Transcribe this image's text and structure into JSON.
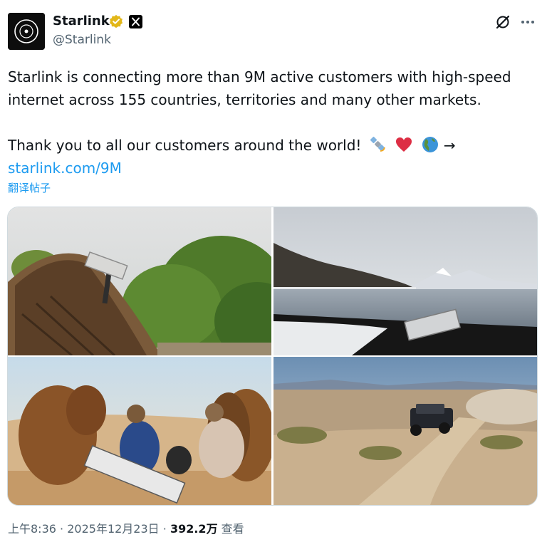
{
  "author": {
    "display_name": "Starlink",
    "handle": "@Starlink",
    "verified_color": "#e2b719",
    "avatar_icon": "starlink-logo",
    "affiliate_badge": "x-logo"
  },
  "header_icons": {
    "grok": "grok-icon",
    "more": "more-icon"
  },
  "tweet": {
    "line1": "Starlink is connecting more than 9M active customers with high-speed",
    "line2": "internet across 155 countries, territories and many other markets.",
    "line3": "Thank you to all our customers around the world!",
    "emojis": [
      "satellite",
      "red-heart",
      "globe-americas"
    ],
    "arrow": "→",
    "link": "starlink.com/9M"
  },
  "translate_label": "翻译帖子",
  "media": [
    {
      "subject": "Starlink dish on thatched roof with trees"
    },
    {
      "subject": "Starlink dish on vehicle hood by lake with snowy mountain"
    },
    {
      "subject": "Starlink dish in desert with camels and people"
    },
    {
      "subject": "Off-road truck driving through desert"
    }
  ],
  "meta": {
    "time": "上午8:36",
    "separator": "·",
    "date": "2025年12月23日",
    "views_count": "392.2万",
    "views_label": "查看"
  },
  "colors": {
    "text": "#0f1419",
    "secondary": "#536471",
    "link": "#1d9bf0",
    "border": "#cfd9de"
  }
}
